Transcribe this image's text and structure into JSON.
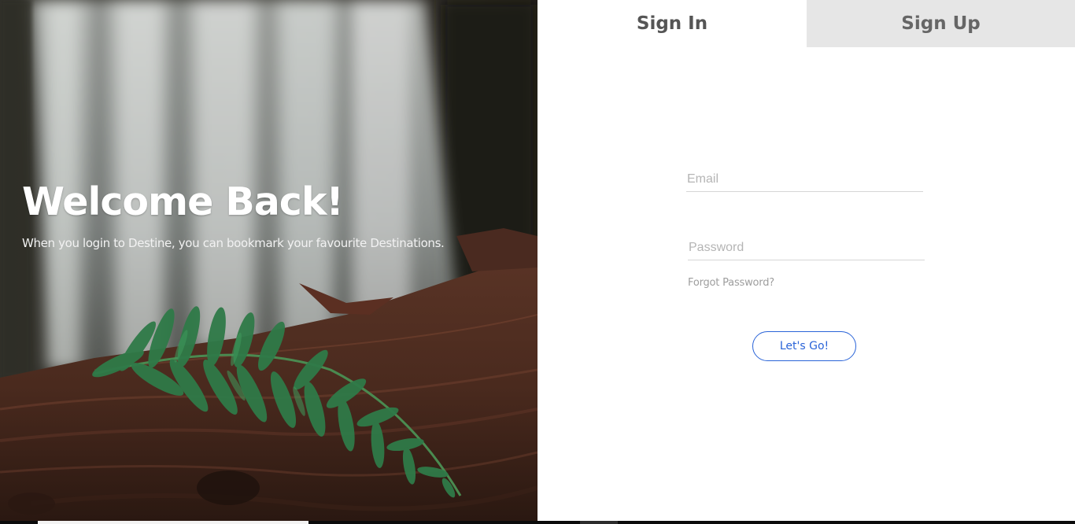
{
  "hero": {
    "title": "Welcome Back!",
    "subtitle": "When you login to Destine, you can bookmark your favourite Destinations."
  },
  "tabs": {
    "sign_in": "Sign In",
    "sign_up": "Sign Up",
    "active": "sign_in"
  },
  "form": {
    "email_placeholder": "Email",
    "email_value": "",
    "password_placeholder": "Password",
    "password_value": "",
    "forgot_label": "Forgot Password?",
    "submit_label": "Let's Go!"
  },
  "colors": {
    "accent": "#2a64d8",
    "inactive_tab": "#e6e6e6",
    "tab_text": "#555555"
  }
}
